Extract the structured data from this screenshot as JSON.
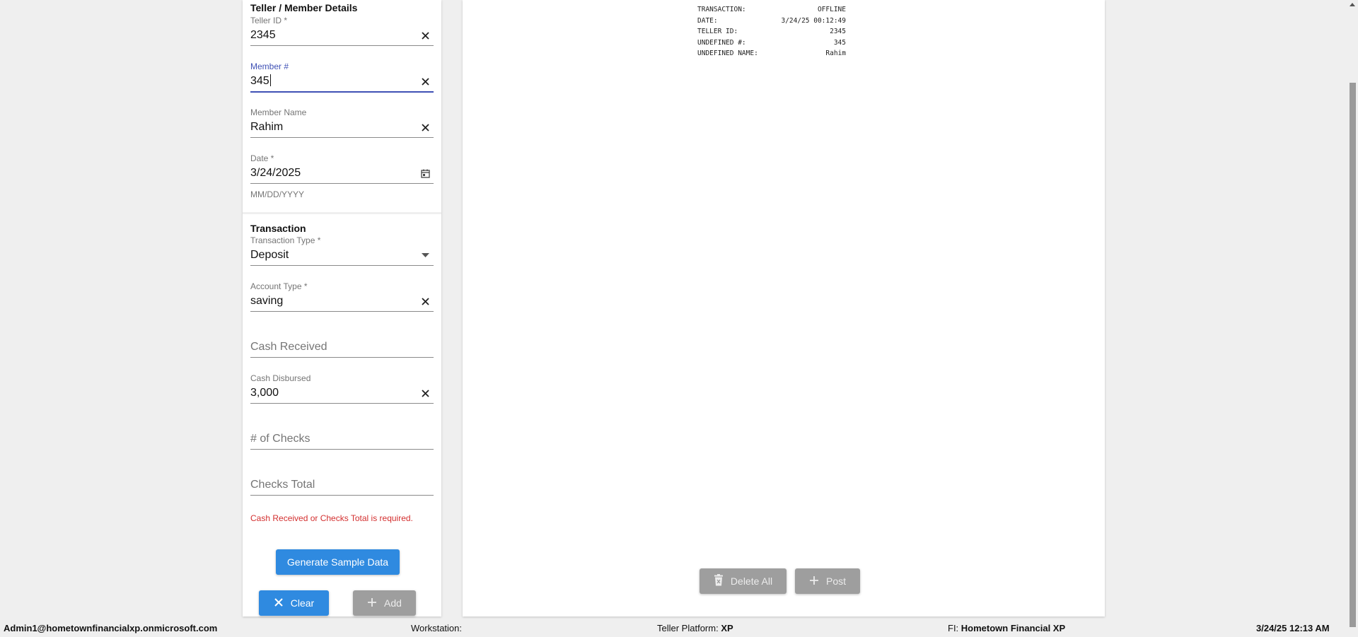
{
  "teller_section": {
    "title": "Teller / Member Details",
    "teller_id": {
      "label": "Teller ID *",
      "value": "2345"
    },
    "member_number": {
      "label": "Member #",
      "value": "345"
    },
    "member_name": {
      "label": "Member Name",
      "value": "Rahim"
    },
    "date": {
      "label": "Date *",
      "value": "3/24/2025",
      "helper": "MM/DD/YYYY"
    }
  },
  "transaction_section": {
    "title": "Transaction",
    "transaction_type": {
      "label": "Transaction Type *",
      "value": "Deposit"
    },
    "account_type": {
      "label": "Account Type *",
      "value": "saving"
    },
    "cash_received": {
      "placeholder": "Cash Received"
    },
    "cash_disbursed": {
      "label": "Cash Disbursed",
      "value": "3,000"
    },
    "num_checks": {
      "placeholder": "# of Checks"
    },
    "checks_total": {
      "placeholder": "Checks Total"
    },
    "error": "Cash Received or Checks Total is required."
  },
  "buttons": {
    "generate": "Generate Sample Data",
    "clear": "Clear",
    "add": "Add",
    "delete_all": "Delete All",
    "post": "Post"
  },
  "receipt": [
    {
      "key": "TRANSACTION:",
      "value": "OFFLINE"
    },
    {
      "key": "DATE:",
      "value": "3/24/25 00:12:49"
    },
    {
      "key": "TELLER ID:",
      "value": "2345"
    },
    {
      "key": "UNDEFINED #:",
      "value": "345"
    },
    {
      "key": "UNDEFINED NAME:",
      "value": "Rahim"
    }
  ],
  "status_bar": {
    "user": "Admin1@hometownfinancialxp.onmicrosoft.com",
    "workstation_label": "Workstation:",
    "workstation_value": "",
    "platform_label": "Teller Platform:",
    "platform_value": "XP",
    "fi_label": "FI:",
    "fi_value": "Hometown Financial XP",
    "datetime": "3/24/25 12:13 AM"
  },
  "colors": {
    "primary": "#2f8ae0",
    "focus": "#3f51b5",
    "error": "#d32f2f",
    "disabled_button": "#9e9e9e"
  }
}
